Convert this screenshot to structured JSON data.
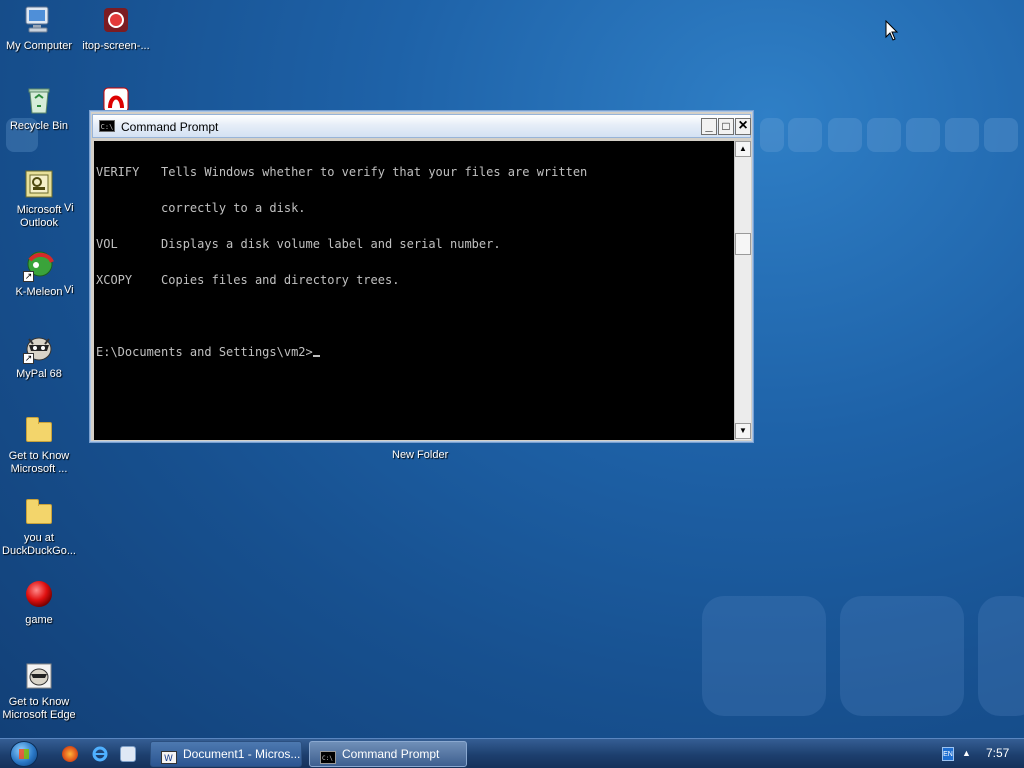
{
  "desktop": {
    "icons": [
      {
        "label": "My Computer",
        "icon": "computer-icon"
      },
      {
        "label": "itop-screen-...",
        "icon": "recorder-app-icon"
      },
      {
        "label": "Recycle Bin",
        "icon": "recycle-bin-icon"
      },
      {
        "label": "Microsoft Outlook",
        "icon": "outlook-icon"
      },
      {
        "label": "K-Meleon",
        "icon": "k-meleon-icon"
      },
      {
        "label": "MyPal 68",
        "icon": "mypal-icon"
      },
      {
        "label": "Get to Know Microsoft ...",
        "icon": "folder-icon"
      },
      {
        "label": "you at DuckDuckGo...",
        "icon": "folder-icon"
      },
      {
        "label": "game",
        "icon": "game-icon"
      },
      {
        "label": "Get to Know Microsoft Edge",
        "icon": "mypal-icon"
      }
    ],
    "partial_labels": {
      "vi1": "Vi",
      "vi2": "Vi"
    },
    "new_folder_label": "New Folder"
  },
  "cmd_window": {
    "title": "Command Prompt",
    "title_icon_text": "C:\\",
    "buttons": {
      "minimize": "_",
      "maximize": "□",
      "close": "×"
    },
    "lines": [
      "VERIFY   Tells Windows whether to verify that your files are written",
      "         correctly to a disk.",
      "VOL      Displays a disk volume label and serial number.",
      "XCOPY    Copies files and directory trees.",
      "",
      "E:\\Documents and Settings\\vm2>"
    ],
    "scroll_up": "▲",
    "scroll_down": "▼"
  },
  "taskbar": {
    "tasks": [
      {
        "label": "Document1 - Micros...",
        "active": false
      },
      {
        "label": "Command Prompt",
        "active": true
      }
    ],
    "tray": {
      "lang": "EN",
      "show_hidden": "▲",
      "clock": "7:57"
    }
  },
  "colors": {
    "desktop_blue": "#1e62a8",
    "console_bg": "#000000",
    "console_fg": "#c0c0c0"
  }
}
